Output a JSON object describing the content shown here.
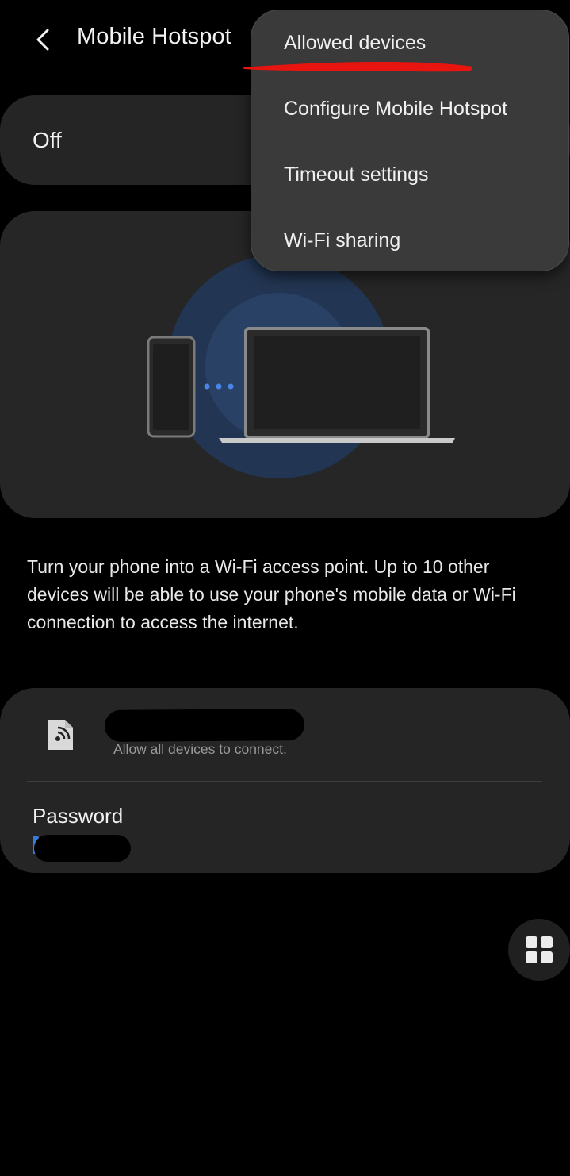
{
  "header": {
    "title": "Mobile Hotspot",
    "back_icon": "chevron-left-icon"
  },
  "toggle": {
    "label": "Off"
  },
  "illustration": {
    "phone": "phone-icon",
    "laptop": "laptop-icon",
    "accent": "#2f5aa6"
  },
  "description": "Turn your phone into a Wi-Fi access point. Up to 10 other devices will be able to use your phone's mobile data or Wi-Fi connection to access the internet.",
  "network": {
    "icon": "hotspot-device-icon",
    "subtitle": "Allow all devices to connect.",
    "password_label": "Password"
  },
  "fab": {
    "icon": "grid-icon"
  },
  "menu": {
    "items": [
      {
        "label": "Allowed devices"
      },
      {
        "label": "Configure Mobile Hotspot"
      },
      {
        "label": "Timeout settings"
      },
      {
        "label": "Wi-Fi sharing"
      }
    ],
    "annotation_color": "#e8140f"
  },
  "colors": {
    "background": "#000000",
    "card": "#252525",
    "menu": "#3a3a3a",
    "link_blue": "#3b7bd8"
  }
}
